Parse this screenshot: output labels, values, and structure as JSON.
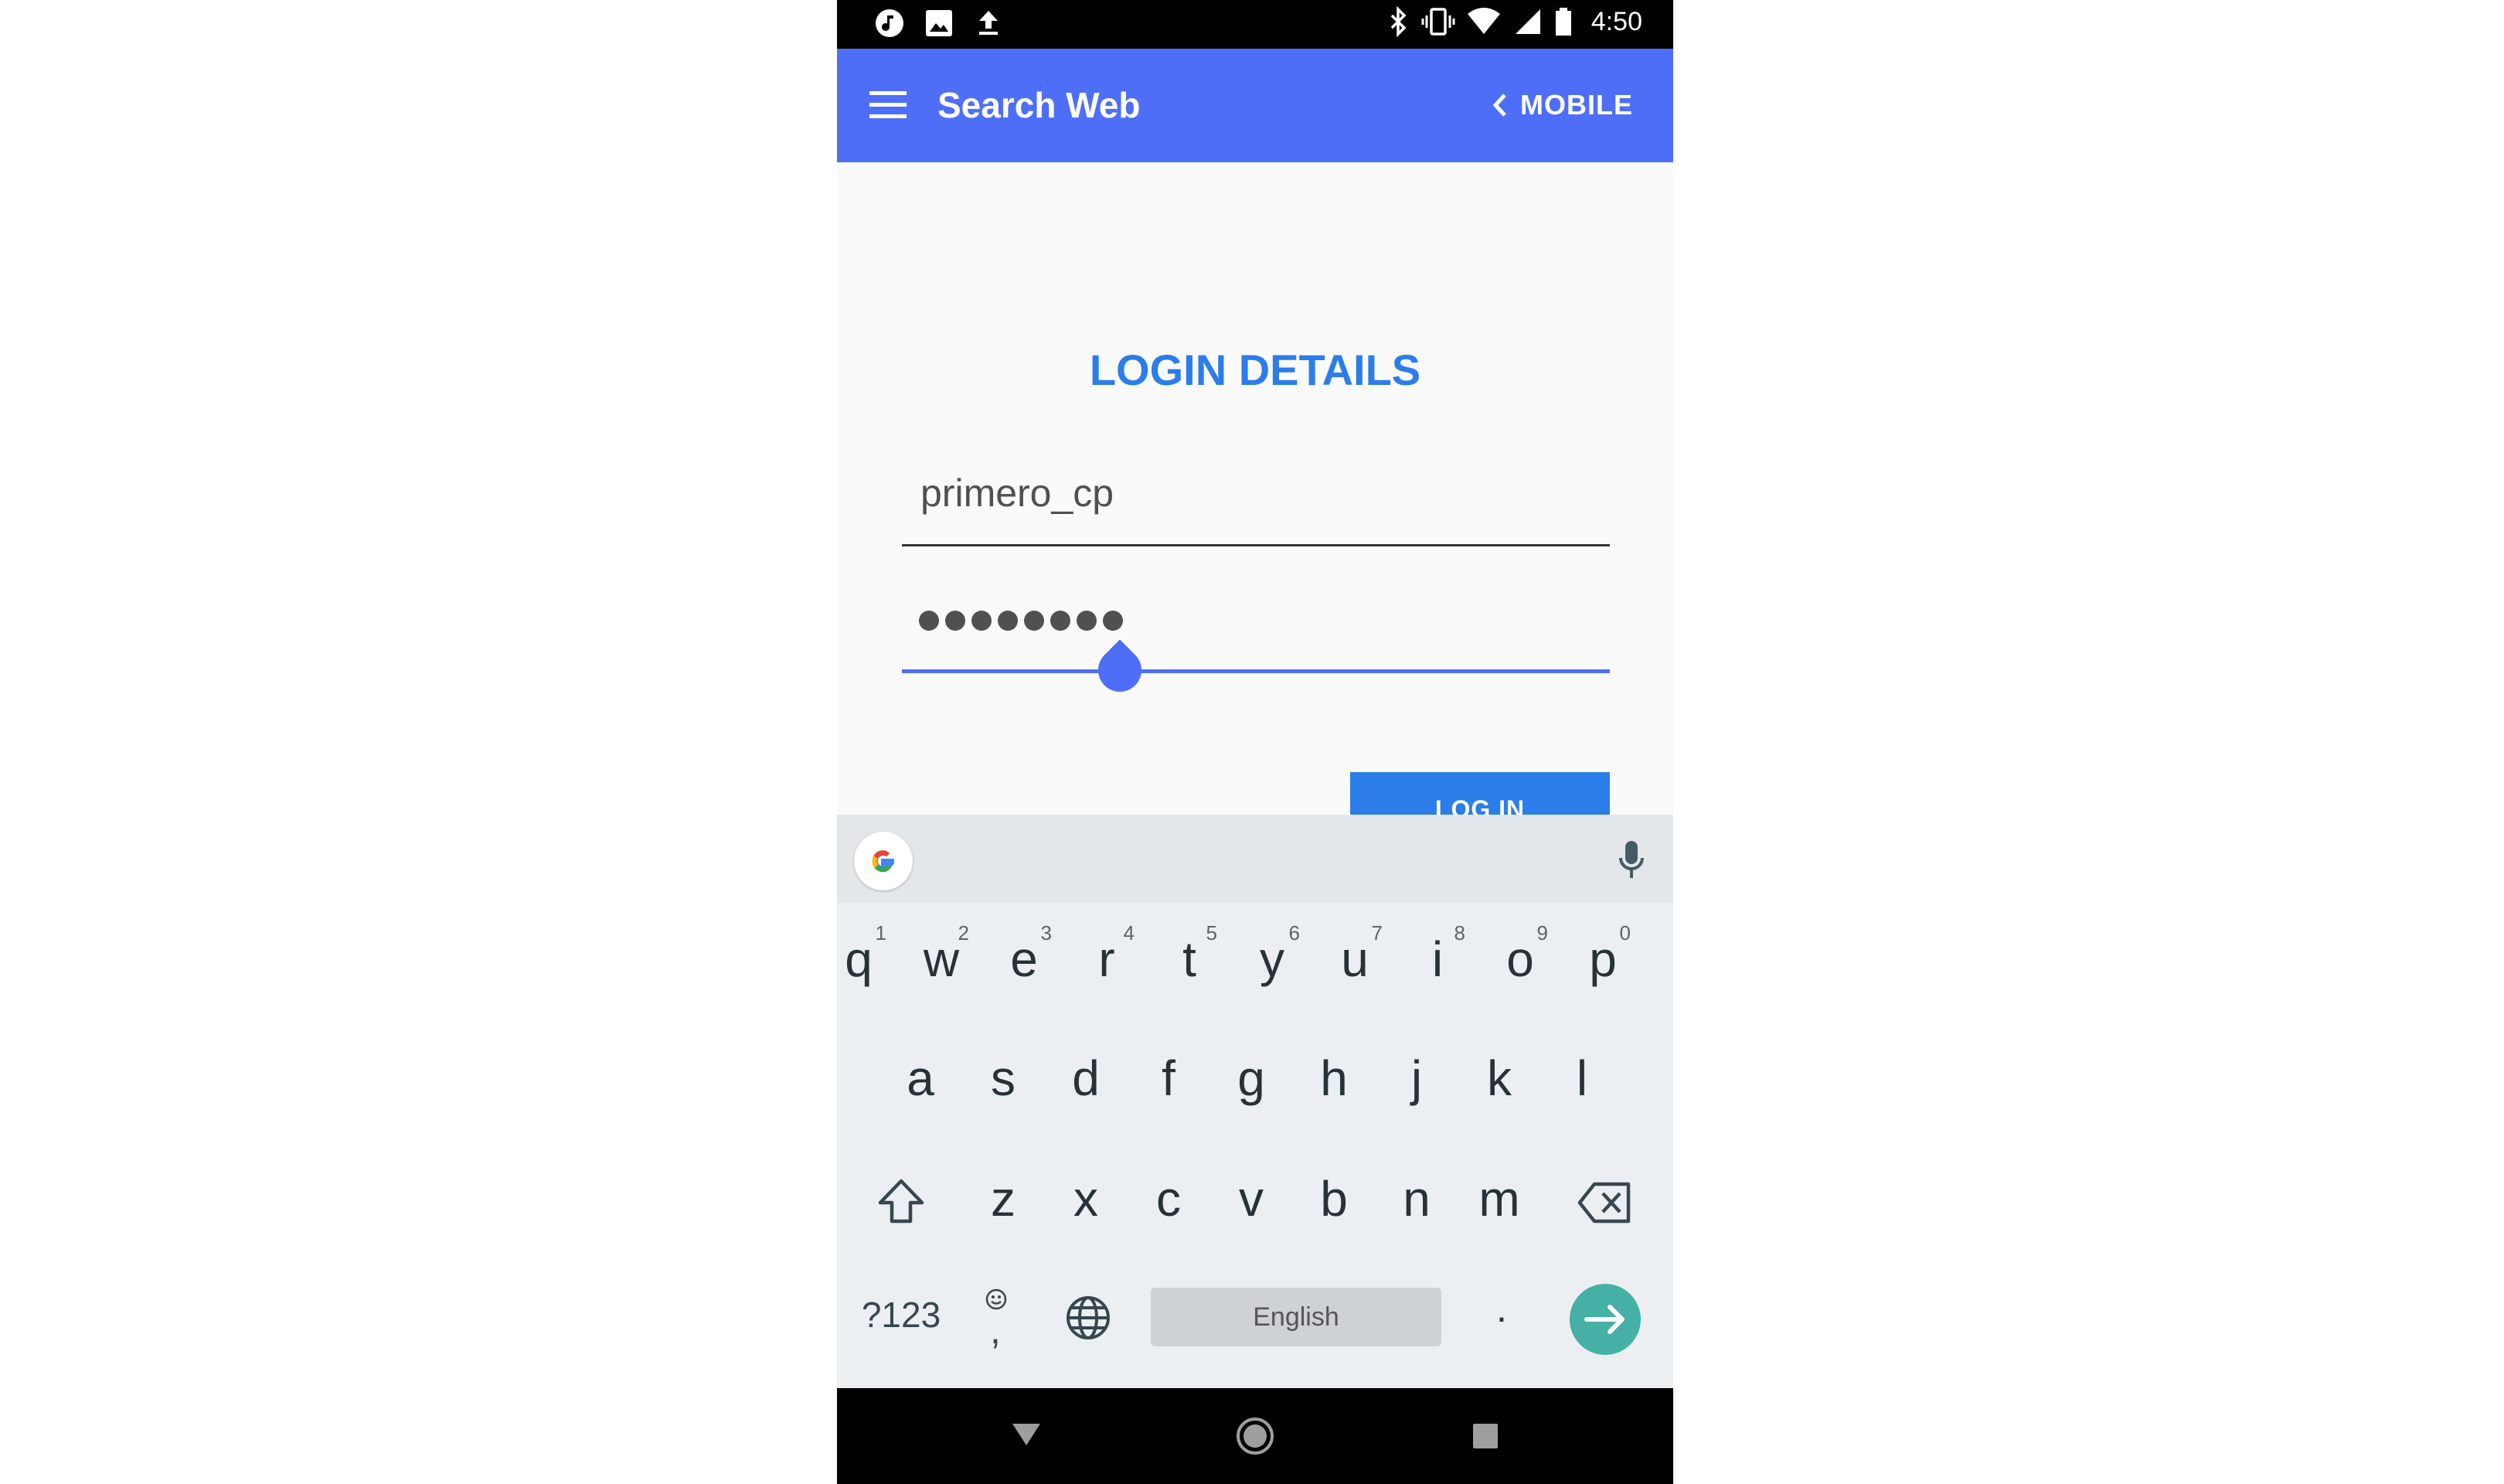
{
  "status_bar": {
    "time": "4:50",
    "left_icons": [
      "music-icon",
      "image-icon",
      "upload-icon"
    ],
    "right_icons": [
      "bluetooth-icon",
      "vibrate-icon",
      "wifi-icon",
      "signal-icon",
      "battery-icon"
    ]
  },
  "app_bar": {
    "title": "Search Web",
    "mobile_label": "MOBILE",
    "color": "#4f6ef7"
  },
  "login": {
    "heading": "LOGIN DETAILS",
    "username_value": "primero_cp",
    "password_mask": "••••••••",
    "button_label": "LOG IN",
    "accent_color": "#2b7de9"
  },
  "keyboard": {
    "row1": [
      {
        "key": "q",
        "num": "1"
      },
      {
        "key": "w",
        "num": "2"
      },
      {
        "key": "e",
        "num": "3"
      },
      {
        "key": "r",
        "num": "4"
      },
      {
        "key": "t",
        "num": "5"
      },
      {
        "key": "y",
        "num": "6"
      },
      {
        "key": "u",
        "num": "7"
      },
      {
        "key": "i",
        "num": "8"
      },
      {
        "key": "o",
        "num": "9"
      },
      {
        "key": "p",
        "num": "0"
      }
    ],
    "row2": [
      "a",
      "s",
      "d",
      "f",
      "g",
      "h",
      "j",
      "k",
      "l"
    ],
    "row3": [
      "z",
      "x",
      "c",
      "v",
      "b",
      "n",
      "m"
    ],
    "symbols_label": "?123",
    "comma_label": ",",
    "period_label": ".",
    "space_label": "English",
    "enter_color": "#45b0a6"
  },
  "nav_bar": {
    "icons": [
      "back-icon",
      "home-icon",
      "recents-icon"
    ]
  }
}
